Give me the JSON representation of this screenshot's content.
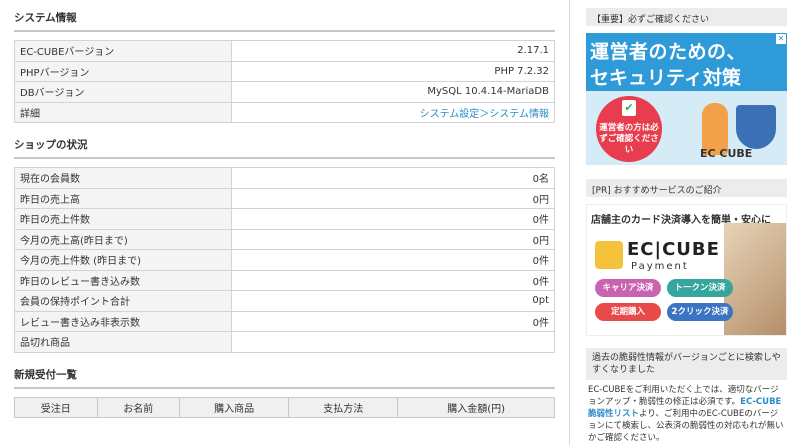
{
  "system": {
    "title": "システム情報",
    "rows": [
      {
        "label": "EC-CUBEバージョン",
        "value": "2.17.1"
      },
      {
        "label": "PHPバージョン",
        "value": "PHP 7.2.32"
      },
      {
        "label": "DBバージョン",
        "value": "MySQL 10.4.14-MariaDB"
      },
      {
        "label": "詳細",
        "value": "システム設定＞システム情報"
      }
    ]
  },
  "shop": {
    "title": "ショップの状況",
    "rows": [
      {
        "label": "現在の会員数",
        "value": "0名"
      },
      {
        "label": "昨日の売上高",
        "value": "0円"
      },
      {
        "label": "昨日の売上件数",
        "value": "0件"
      },
      {
        "label": "今月の売上高(昨日まで)",
        "value": "0円"
      },
      {
        "label": "今月の売上件数 (昨日まで)",
        "value": "0件"
      },
      {
        "label": "昨日のレビュー書き込み数",
        "value": "0件"
      },
      {
        "label": "会員の保持ポイント合計",
        "value": "0pt"
      },
      {
        "label": "レビュー書き込み非表示数",
        "value": "0件"
      },
      {
        "label": "品切れ商品",
        "value": ""
      }
    ]
  },
  "orders": {
    "title": "新規受付一覧",
    "columns": [
      "受注日",
      "お名前",
      "購入商品",
      "支払方法",
      "購入金額(円)"
    ]
  },
  "sidebar": {
    "important_title": "【重要】必ずご確認ください",
    "banner1": {
      "line1": "運営者のための、",
      "line2": "セキュリティ対策",
      "circle": "運営者の方は必ずご確認ください",
      "logo": "EC CUBE"
    },
    "pr_title": "[PR] おすすめサービスのご紹介",
    "banner2": {
      "headline": "店舗主のカード決済導入を簡単・安心に",
      "logo": "EC|CUBE",
      "sub": "Payment",
      "pills": [
        "キャリア決済",
        "トークン決済",
        "定期購入",
        "2クリック決済"
      ]
    },
    "vuln_title": "過去の脆弱性情報がバージョンごとに検索しやすくなりました",
    "vuln_text_1": "EC-CUBEをご利用いただく上では、適切なバージョンアップ・脆弱性の修正は必須です。",
    "vuln_link": "EC-CUBE脆弱性リスト",
    "vuln_text_2": "より、ご利用中のEC-CUBEのバージョンにて検索し、公表済の脆弱性の対応もれが無いかご確認ください。"
  },
  "colors": {
    "link": "#2a8cc8",
    "banner_blue": "#2e9ad8",
    "banner_red": "#e73d4e"
  }
}
